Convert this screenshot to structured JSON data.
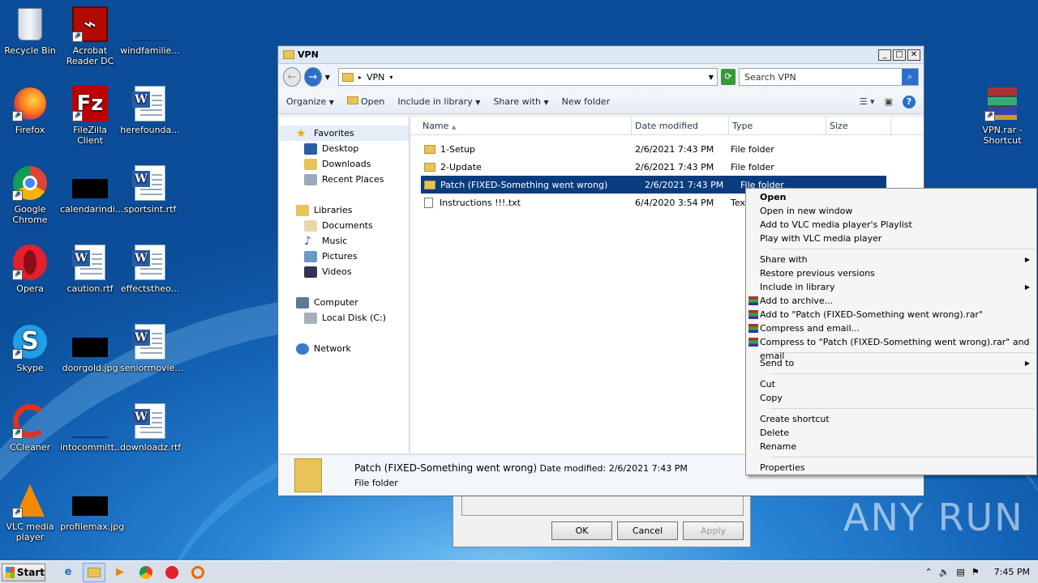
{
  "desktop_icons": [
    {
      "label": "Recycle Bin",
      "icon": "recycle-bin-icon"
    },
    {
      "label": "Acrobat Reader DC",
      "icon": "acrobat-icon"
    },
    {
      "label": "windfamilie...",
      "icon": "file-icon"
    },
    {
      "label": "Firefox",
      "icon": "firefox-icon"
    },
    {
      "label": "FileZilla Client",
      "icon": "filezilla-icon"
    },
    {
      "label": "herefounda...",
      "icon": "word-doc-icon"
    },
    {
      "label": "Google Chrome",
      "icon": "chrome-icon"
    },
    {
      "label": "calendarindi...",
      "icon": "image-icon"
    },
    {
      "label": "sportsint.rtf",
      "icon": "word-doc-icon"
    },
    {
      "label": "Opera",
      "icon": "opera-icon"
    },
    {
      "label": "caution.rtf",
      "icon": "word-doc-icon"
    },
    {
      "label": "effectstheo...",
      "icon": "word-doc-icon"
    },
    {
      "label": "Skype",
      "icon": "skype-icon"
    },
    {
      "label": "doorgold.jpg",
      "icon": "image-icon"
    },
    {
      "label": "seniormovie...",
      "icon": "word-doc-icon"
    },
    {
      "label": "CCleaner",
      "icon": "ccleaner-icon"
    },
    {
      "label": "intocommitt...",
      "icon": "file-icon"
    },
    {
      "label": "downloadz.rtf",
      "icon": "word-doc-icon"
    },
    {
      "label": "VLC media player",
      "icon": "vlc-icon"
    },
    {
      "label": "profilemax.jpg",
      "icon": "image-icon"
    },
    {
      "label": "VPN.rar - Shortcut",
      "icon": "winrar-icon"
    }
  ],
  "window": {
    "title": "VPN",
    "address": "VPN",
    "search_placeholder": "Search VPN",
    "commands": [
      "Organize",
      "Open",
      "Include in library",
      "Share with",
      "New folder"
    ],
    "nav": {
      "favorites": "Favorites",
      "favorites_items": [
        "Desktop",
        "Downloads",
        "Recent Places"
      ],
      "libraries": "Libraries",
      "libraries_items": [
        "Documents",
        "Music",
        "Pictures",
        "Videos"
      ],
      "computer": "Computer",
      "computer_items": [
        "Local Disk (C:)"
      ],
      "network": "Network"
    },
    "columns": [
      "Name",
      "Date modified",
      "Type",
      "Size"
    ],
    "files": [
      {
        "name": "1-Setup",
        "date": "2/6/2021 7:43 PM",
        "type": "File folder"
      },
      {
        "name": "2-Update",
        "date": "2/6/2021 7:43 PM",
        "type": "File folder"
      },
      {
        "name": "Patch (FIXED-Something went wrong)",
        "date": "2/6/2021 7:43 PM",
        "type": "File folder"
      },
      {
        "name": "Instructions !!!.txt",
        "date": "6/4/2020 3:54 PM",
        "type": "Tex"
      }
    ],
    "details": {
      "name": "Patch (FIXED-Something went wrong)",
      "modified": "Date modified: 2/6/2021 7:43 PM",
      "type": "File folder"
    }
  },
  "dialog": {
    "ok": "OK",
    "cancel": "Cancel",
    "apply": "Apply"
  },
  "context_menu": {
    "group1": [
      "Open",
      "Open in new window",
      "Add to VLC media player's Playlist",
      "Play with VLC media player"
    ],
    "group2": [
      "Share with",
      "Restore previous versions",
      "Include in library",
      "Add to archive...",
      "Add to \"Patch (FIXED-Something went wrong).rar\"",
      "Compress and email...",
      "Compress to \"Patch (FIXED-Something went wrong).rar\" and email"
    ],
    "group3": [
      "Send to"
    ],
    "group4": [
      "Cut",
      "Copy"
    ],
    "group5": [
      "Create shortcut",
      "Delete",
      "Rename"
    ],
    "group6": [
      "Properties"
    ]
  },
  "taskbar": {
    "start": "Start",
    "time": "7:45 PM"
  },
  "watermark": "ANY RUN"
}
